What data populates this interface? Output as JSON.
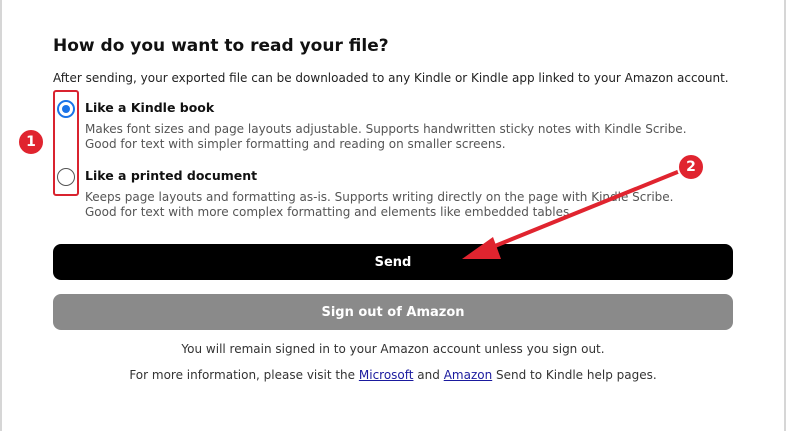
{
  "heading": "How do you want to read your file?",
  "intro": "After sending, your exported file can be downloaded to any Kindle or Kindle app linked to your Amazon account.",
  "options": [
    {
      "title": "Like a Kindle book",
      "desc_line1": "Makes font sizes and page layouts adjustable. Supports handwritten sticky notes with Kindle Scribe.",
      "desc_line2": "Good for text with simpler formatting and reading on smaller screens.",
      "selected": true
    },
    {
      "title": "Like a printed document",
      "desc_line1": "Keeps page layouts and formatting as-is. Supports writing directly on the page with Kindle Scribe.",
      "desc_line2": "Good for text with more complex formatting and elements like embedded tables.",
      "selected": false
    }
  ],
  "buttons": {
    "send": "Send",
    "signout": "Sign out of Amazon"
  },
  "notes": {
    "line1": "You will remain signed in to your Amazon account unless you sign out.",
    "line2_prefix": "For more information, please visit the ",
    "link_microsoft": "Microsoft",
    "line2_and": " and ",
    "link_amazon": "Amazon",
    "line2_suffix": " Send to Kindle help pages."
  },
  "annotations": {
    "badge1": "1",
    "badge2": "2",
    "color": "#e0242f"
  },
  "colors": {
    "radio_selected": "#1a73e8",
    "send_bg": "#000000",
    "signout_bg": "#8a8a8a"
  }
}
